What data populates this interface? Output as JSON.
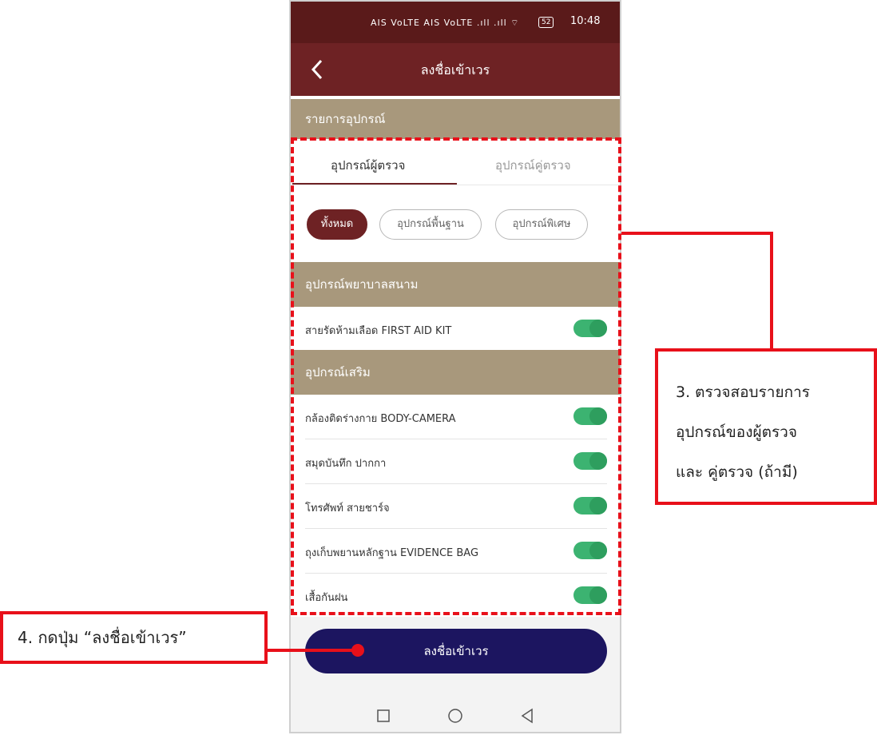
{
  "status_bar": {
    "carriers": "AIS VoLTE  AIS VoLTE  .ıll .ıll ⌔",
    "battery": "52",
    "time": "10:48"
  },
  "app_bar": {
    "title": "ลงชื่อเข้าเวร"
  },
  "section_equipment": {
    "title": "รายการอุปกรณ์"
  },
  "tabs": [
    {
      "label": "อุปกรณ์ผู้ตรวจ",
      "selected": true
    },
    {
      "label": "อุปกรณ์คู่ตรวจ",
      "selected": false
    }
  ],
  "filters": [
    {
      "label": "ทั้งหมด",
      "selected": true
    },
    {
      "label": "อุปกรณ์พื้นฐาน",
      "selected": false
    },
    {
      "label": "อุปกรณ์พิเศษ",
      "selected": false
    }
  ],
  "groups": [
    {
      "title": "อุปกรณ์พยาบาลสนาม",
      "items": [
        {
          "label": "สายรัดห้ามเลือด FIRST AID KIT",
          "on": true
        }
      ]
    },
    {
      "title": "อุปกรณ์เสริม",
      "items": [
        {
          "label": "กล้องติดร่างกาย BODY-CAMERA",
          "on": true
        },
        {
          "label": "สมุดบันทึก ปากกา",
          "on": true
        },
        {
          "label": "โทรศัพท์ สายชาร์จ",
          "on": true
        },
        {
          "label": "ถุงเก็บพยานหลักฐาน EVIDENCE BAG",
          "on": true
        },
        {
          "label": "เสื้อกันฝน",
          "on": true
        }
      ]
    }
  ],
  "submit": {
    "label": "ลงชื่อเข้าเวร"
  },
  "annotations": {
    "step3": [
      "3. ตรวจสอบรายการ",
      "อุปกรณ์ของผู้ตรวจ",
      "และ คู่ตรวจ (ถ้ามี)"
    ],
    "step4": "4. กดปุ่ม “ลงชื่อเข้าเวร”"
  },
  "colors": {
    "status_bar": "#5a1a1a",
    "app_bar": "#6e2224",
    "section": "#a8987c",
    "toggle_on": "#3cb371",
    "submit": "#1c1560",
    "annotation": "#e8101a"
  }
}
